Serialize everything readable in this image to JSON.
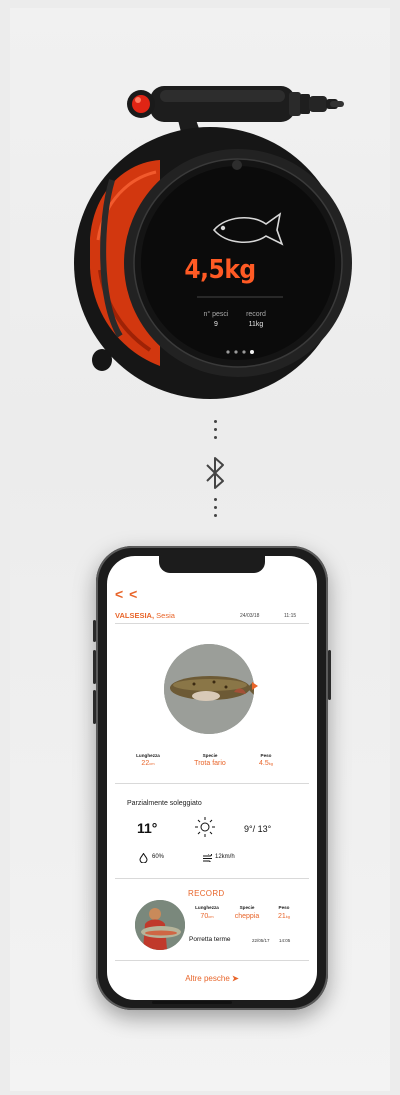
{
  "device": {
    "weight": "4,5kg",
    "stats": [
      {
        "label": "n° pesci",
        "value": "9"
      },
      {
        "label": "record",
        "value": "11kg"
      }
    ],
    "page_dots": 4,
    "active_page": 4,
    "accent": "#ff5a24"
  },
  "connection": {
    "icon": "bluetooth-icon"
  },
  "app": {
    "back_label": "< <",
    "header": {
      "location": "VALSESIA,",
      "sublocation": "Sesia",
      "date": "24/03/18",
      "time": "11:15"
    },
    "catch": {
      "columns": [
        {
          "header": "Lunghezza",
          "value": "22",
          "unit": "cm"
        },
        {
          "header": "Specie",
          "value": "Trota fario",
          "unit": ""
        },
        {
          "header": "Peso",
          "value": "4.5",
          "unit": "kg"
        }
      ]
    },
    "weather": {
      "description": "Parzialmente soleggiato",
      "temperature": "11°",
      "icon": "sun-icon",
      "min_max": "9°/ 13°",
      "humidity": "60%",
      "wind": "12km/h"
    },
    "record": {
      "title": "RECORD",
      "columns": [
        {
          "header": "Lunghezza",
          "value": "70",
          "unit": "cm"
        },
        {
          "header": "Specie",
          "value": "cheppia",
          "unit": ""
        },
        {
          "header": "Peso",
          "value": "21",
          "unit": "kg"
        }
      ],
      "place": "Porretta terme",
      "date": "22/05/17",
      "time": "14:05"
    },
    "more_link": "Altre pesche",
    "accent": "#e8652a"
  }
}
